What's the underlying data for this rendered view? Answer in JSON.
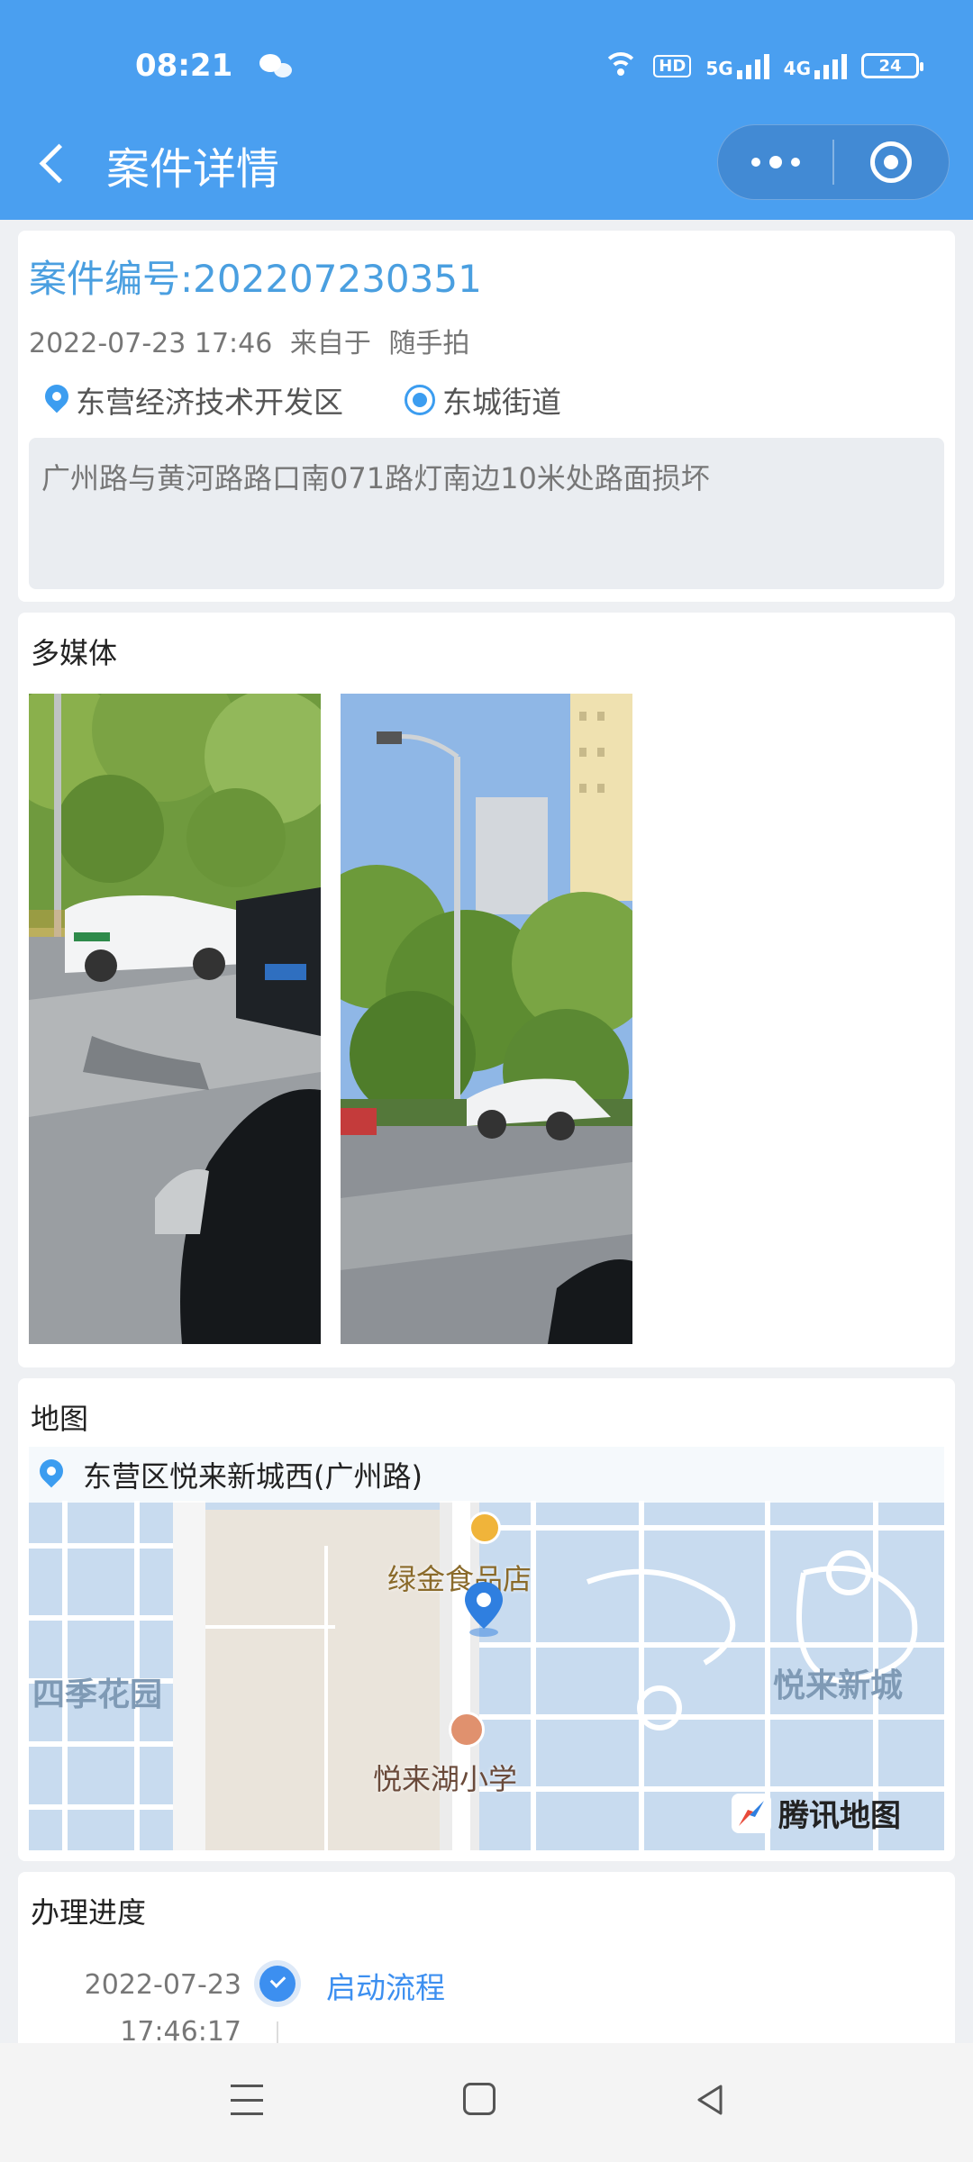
{
  "status_bar": {
    "time": "08:21",
    "hd": "HD",
    "net1": "5G",
    "net2": "4G",
    "battery": "24"
  },
  "nav": {
    "title": "案件详情"
  },
  "case": {
    "number_label": "案件编号:202207230351",
    "datetime": "2022-07-23 17:46",
    "source_prefix": "来自于",
    "source": "随手拍",
    "district": "东营经济技术开发区",
    "street": "东城街道",
    "description": "广州路与黄河路路口南071路灯南边10米处路面损坏"
  },
  "media": {
    "title": "多媒体",
    "photos": [
      "photo-street-cars",
      "photo-street-lamp"
    ]
  },
  "map": {
    "title": "地图",
    "address": "东营区悦来新城西(广州路)",
    "pois": {
      "shop": "绿金食品店",
      "school": "悦来湖小学",
      "park": "四季花园",
      "area": "悦来新城"
    },
    "brand": "腾讯地图"
  },
  "progress": {
    "title": "办理进度",
    "steps": [
      {
        "date": "2022-07-23",
        "time": "17:46:17",
        "label": "启动流程"
      }
    ]
  },
  "colors": {
    "primary": "#4a9ff0",
    "accent_text": "#4a9fe0",
    "step": "#3c8ff0"
  }
}
